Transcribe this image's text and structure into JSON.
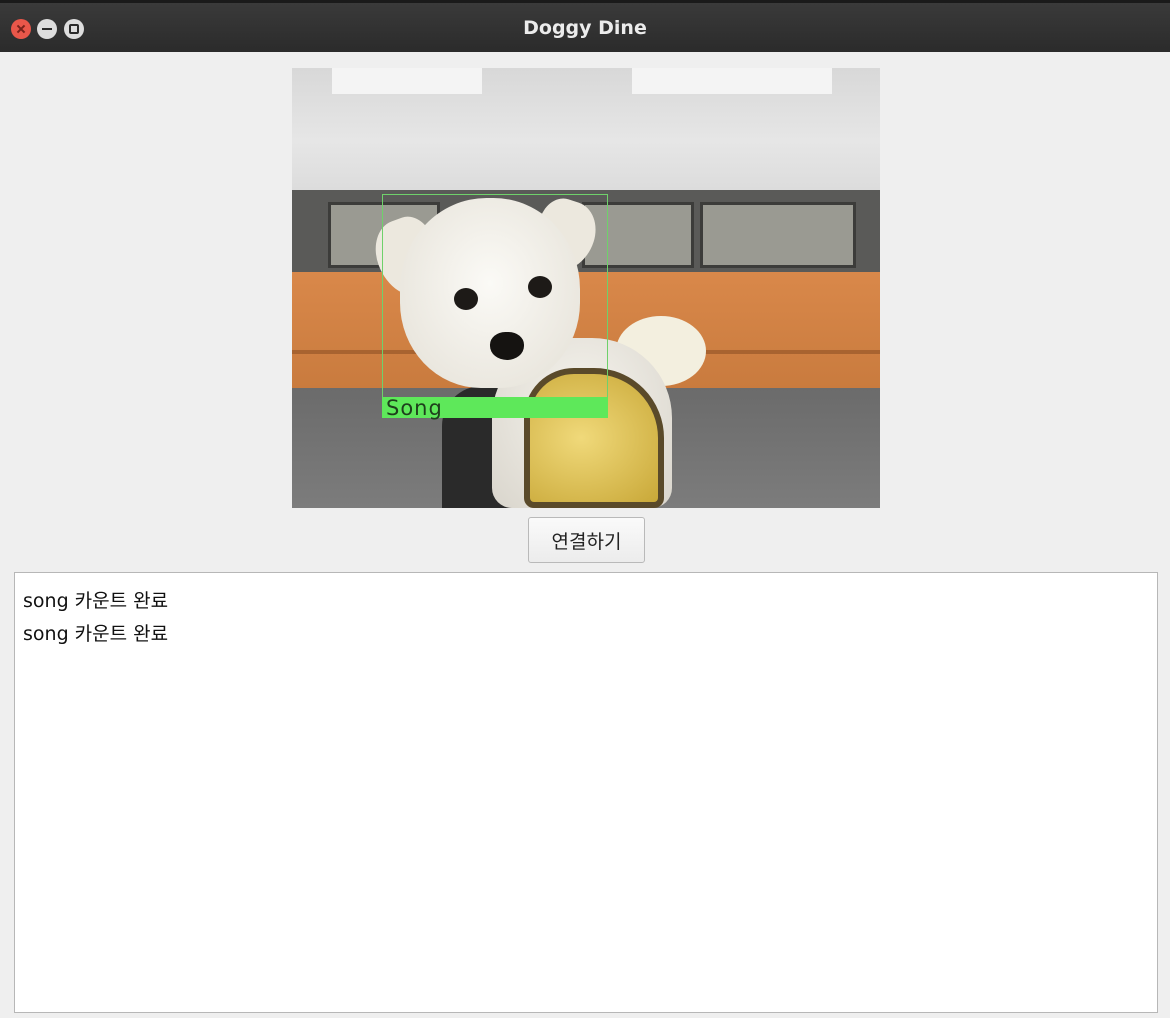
{
  "window": {
    "title": "Doggy Dine"
  },
  "window_controls": {
    "close_icon": "close-icon",
    "minimize_icon": "minimize-icon",
    "maximize_icon": "maximize-icon"
  },
  "camera": {
    "detection_label": "Song",
    "detection_color": "#5ee85a"
  },
  "actions": {
    "connect_label": "연결하기"
  },
  "log": {
    "lines": [
      "song 카운트 완료",
      "song 카운트 완료"
    ]
  }
}
